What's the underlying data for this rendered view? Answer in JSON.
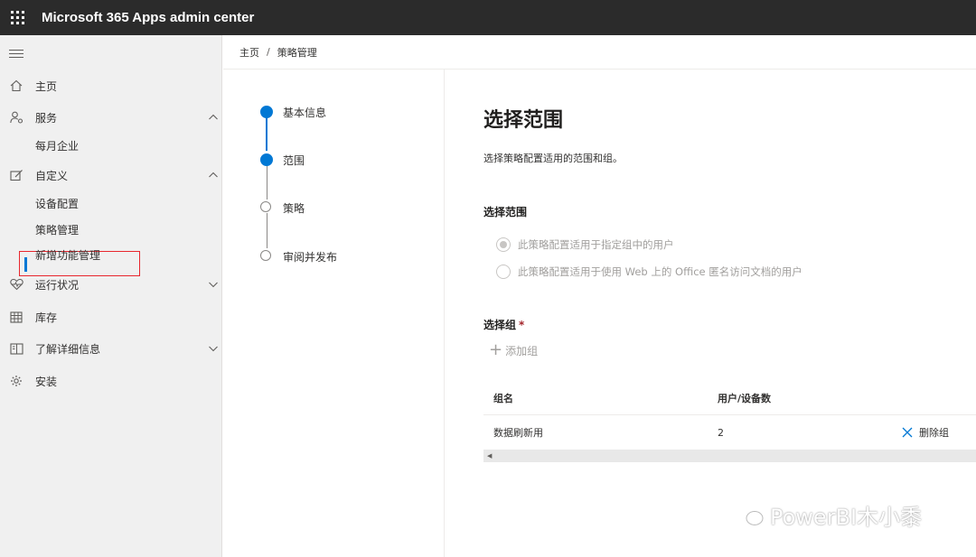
{
  "header": {
    "app_title": "Microsoft 365 Apps admin center"
  },
  "sidebar": {
    "items": [
      {
        "label": "主页",
        "icon": "home-icon"
      },
      {
        "label": "服务",
        "icon": "people-settings-icon",
        "expanded": true
      },
      {
        "label": "每月企业",
        "sub": true
      },
      {
        "label": "自定义",
        "icon": "edit-icon",
        "expanded": true
      },
      {
        "label": "设备配置",
        "sub": true
      },
      {
        "label": "策略管理",
        "sub": true,
        "active": true
      },
      {
        "label": "新增功能管理",
        "sub": true
      },
      {
        "label": "运行状况",
        "icon": "heart-pulse-icon",
        "expanded": false
      },
      {
        "label": "库存",
        "icon": "table-icon"
      },
      {
        "label": "了解详细信息",
        "icon": "book-icon",
        "expanded": false
      },
      {
        "label": "安装",
        "icon": "gear-icon"
      }
    ]
  },
  "breadcrumb": {
    "home": "主页",
    "separator": "/",
    "current": "策略管理"
  },
  "stepper": {
    "steps": [
      {
        "label": "基本信息",
        "state": "complete"
      },
      {
        "label": "范围",
        "state": "current"
      },
      {
        "label": "策略",
        "state": "pending"
      },
      {
        "label": "审阅并发布",
        "state": "pending"
      }
    ]
  },
  "main": {
    "title": "选择范围",
    "description": "选择策略配置适用的范围和组。",
    "scope_label": "选择范围",
    "scope_options": [
      {
        "label": "此策略配置适用于指定组中的用户",
        "selected": true
      },
      {
        "label": "此策略配置适用于使用 Web 上的 Office 匿名访问文档的用户",
        "selected": false
      }
    ],
    "group_label": "选择组",
    "required_mark": "*",
    "add_group": "添加组",
    "table": {
      "columns": [
        "组名",
        "用户/设备数"
      ],
      "rows": [
        {
          "name": "数据刷新用",
          "count": "2",
          "action": "删除组"
        }
      ]
    }
  },
  "watermark": {
    "text": "PowerBI木小黍"
  },
  "colors": {
    "accent": "#0078d4",
    "highlight": "#e8262d",
    "topbar": "#2b2b2b"
  }
}
